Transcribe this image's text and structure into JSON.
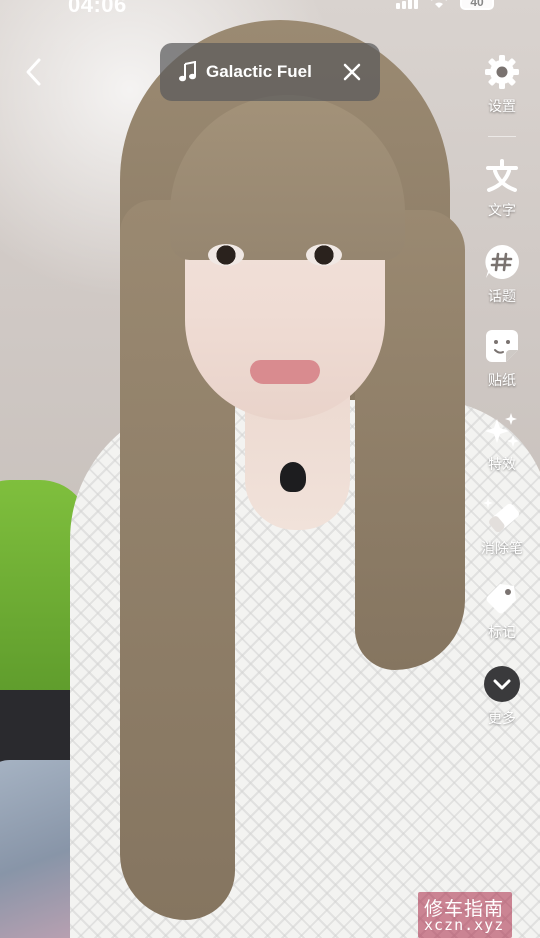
{
  "status_bar": {
    "time": "04:06",
    "battery": "40"
  },
  "music": {
    "title": "Galactic Fuel"
  },
  "toolbar": {
    "items": [
      {
        "label": "设置",
        "icon": "settings-gear-icon"
      },
      {
        "label": "文字",
        "icon": "text-icon"
      },
      {
        "label": "话题",
        "icon": "hashtag-icon"
      },
      {
        "label": "贴纸",
        "icon": "sticker-icon"
      },
      {
        "label": "特效",
        "icon": "sparkle-effects-icon"
      },
      {
        "label": "消除笔",
        "icon": "eraser-icon"
      },
      {
        "label": "标记",
        "icon": "tag-icon"
      },
      {
        "label": "更多",
        "icon": "chevron-down-icon"
      }
    ]
  },
  "watermark": {
    "text_cn": "修车指南",
    "text_en": "xczn.xyz"
  },
  "colors": {
    "pill_bg": "#5a5a5c",
    "icon": "#ffffff"
  }
}
